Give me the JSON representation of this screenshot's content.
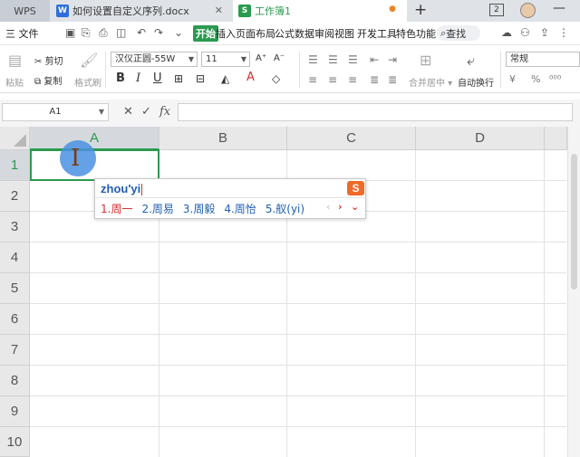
{
  "tabbar": {
    "wps_label": "WPS",
    "doc_icon": "W",
    "doc_tab": "如何设置自定义序列.docx",
    "doc_close": "✕",
    "sheet_icon": "S",
    "sheet_tab": "工作簿1",
    "new_tab": "+",
    "window_badge": "2",
    "minimize": "—"
  },
  "menubar": {
    "file": "三 文件",
    "tabs": [
      "开始",
      "插入",
      "页面布局",
      "公式",
      "数据",
      "审阅",
      "视图",
      "开发工具",
      "特色功能"
    ],
    "active_tab": "开始",
    "search": "查找"
  },
  "ribbon": {
    "paste": "粘贴",
    "cut": "剪切",
    "copy": "复制",
    "format_painter": "格式刷",
    "font_name": "汉仪正圆-55W",
    "font_size": "11",
    "bold": "B",
    "italic": "I",
    "underline": "U",
    "merge_center": "合并居中",
    "wrap_text": "自动换行",
    "number_format": "常规",
    "currency": "¥",
    "percent": "%"
  },
  "formula_bar": {
    "cell_ref": "A1",
    "cancel": "✕",
    "confirm": "✓",
    "fx": "fx",
    "value": ""
  },
  "grid": {
    "columns": [
      "A",
      "B",
      "C",
      "D"
    ],
    "rows": [
      "1",
      "2",
      "3",
      "4",
      "5",
      "6",
      "7",
      "8",
      "9",
      "10"
    ],
    "active_column": "A",
    "active_row": "1"
  },
  "ime": {
    "composition": "zhou'yi",
    "candidates": [
      "1.周一",
      "2.周易",
      "3.周毅",
      "4.周怡",
      "5.舣(yi)"
    ],
    "logo": "S",
    "prev": "‹",
    "next": "›",
    "expand": "⌄"
  },
  "colors": {
    "accent_green": "#2a9a4f",
    "ime_blue": "#1f5fb3",
    "ime_red": "#d63030",
    "ime_logo": "#f06a28",
    "cursor_blue": "#4a90e2"
  }
}
